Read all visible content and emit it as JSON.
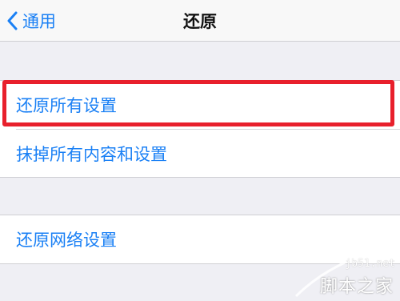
{
  "nav": {
    "back_label": "通用",
    "title": "还原"
  },
  "rows": {
    "reset_all_settings": "还原所有设置",
    "erase_all_content_settings": "抹掉所有内容和设置",
    "reset_network_settings": "还原网络设置"
  },
  "colors": {
    "accent": "#1a80f5",
    "highlight": "#e8202c",
    "background": "#efeff4"
  },
  "watermark": {
    "domain": "jb51.net",
    "brand": "脚本之家"
  }
}
